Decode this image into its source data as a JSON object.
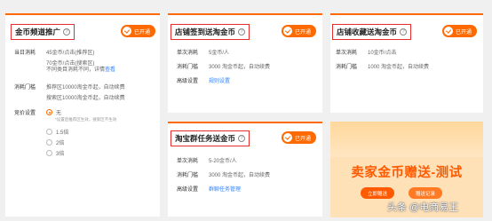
{
  "card1": {
    "title": "金币频道推广",
    "badge": "已开通",
    "rows": [
      {
        "label": "当日消耗",
        "lines": [
          "45金币/点击(推荐区)",
          "70金币/点击(搜索区)"
        ]
      },
      {
        "label": "",
        "text": "不同类目消耗不同，详情",
        "link": "查看"
      },
      {
        "label": "消耗门槛",
        "lines": [
          "推荐区10000淘金币起，自动续费",
          "搜索区10000淘金币起，自动续费"
        ]
      }
    ],
    "bid_label": "竞价设置",
    "bid_options": [
      "无",
      "1.5倍",
      "2倍",
      "3倍"
    ],
    "bid_note": "*设置后推荐区生效，搜索区不生效"
  },
  "card2": {
    "title": "店铺签到送淘金币",
    "badge": "已开通",
    "rows": [
      {
        "label": "单次消耗",
        "value": "5金币/人"
      },
      {
        "label": "消耗门槛",
        "value": "3000 淘金币起，自动续费"
      },
      {
        "label": "高级设置",
        "link": "规则设置"
      }
    ]
  },
  "card3": {
    "title": "店铺收藏送淘金币",
    "badge": "已开通",
    "rows": [
      {
        "label": "单次消耗",
        "value": "10金币/点击"
      },
      {
        "label": "消耗门槛",
        "value": "1000 淘金币起，自动续费"
      }
    ]
  },
  "card4": {
    "title": "淘宝群任务送金币",
    "badge": "已开通",
    "rows": [
      {
        "label": "单次消耗",
        "value": "5-20金币/人"
      },
      {
        "label": "消耗门槛",
        "value": "3000 淘金币起，自动续费"
      },
      {
        "label": "高级设置",
        "link": "群聊任务管理"
      }
    ]
  },
  "promo": {
    "title": "卖家金币赠送-测试",
    "btn_primary": "立即赠送",
    "btn_secondary": "赠送记录"
  },
  "watermark": "头条 @电商易王",
  "colors": {
    "accent": "#ff6a00",
    "highlight_border": "#e62c2c",
    "link": "#3385ff"
  }
}
